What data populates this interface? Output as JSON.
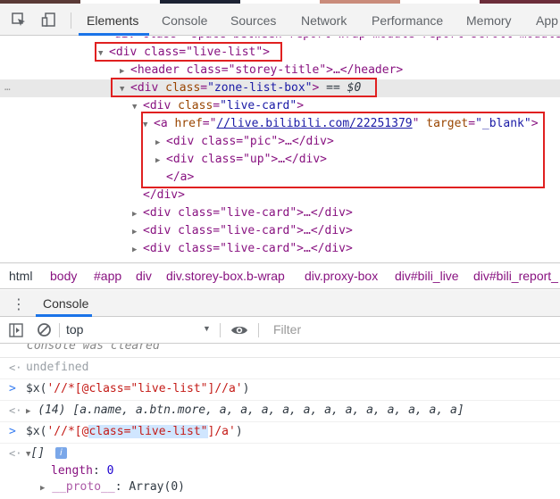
{
  "topbar": {
    "tabs": [
      "Elements",
      "Console",
      "Sources",
      "Network",
      "Performance",
      "Memory",
      "App"
    ],
    "active_tab": "Elements"
  },
  "tree": {
    "cut_line": "‹div class=\"space-between report-wrap-module report-scroll-module›",
    "live_list_open": "<div class=\"live-list\">",
    "header_line": "<header class=\"storey-title\">…</header>",
    "zone_list_tag": "div",
    "zone_list_attr": "class",
    "zone_list_val": "\"zone-list-box\"",
    "zone_list_suffix": "== $0",
    "live_card_tag": "div",
    "live_card_attr": "class",
    "live_card_val": "\"live-card\"",
    "a_tag": "a",
    "a_href_attr": "href",
    "a_href_val": "//live.bilibili.com/22251379",
    "a_target_attr": "target",
    "a_target_val": "\"_blank\"",
    "pic_line": "<div class=\"pic\">…</div>",
    "up_line": "<div class=\"up\">…</div>",
    "a_close": "</a>",
    "div_close": "</div>",
    "live_card_collapsed": "<div class=\"live-card\">…</div>",
    "dots": "…"
  },
  "breadcrumb": [
    "html",
    "body",
    "#app",
    "div",
    "div.storey-box.b-wrap",
    "div.proxy-box",
    "div#bili_live",
    "div#bili_report_"
  ],
  "drawer": {
    "title": "Console",
    "kebab": "⋮"
  },
  "console_toolbar": {
    "context": "top",
    "filter_placeholder": "Filter"
  },
  "console": {
    "cleared": "Console was cleared",
    "undefined_result": "undefined",
    "cmd1_prefix": "$x(",
    "cmd1_str": "'//*[@class=\"live-list\"]//a'",
    "cmd1_suffix": ")",
    "result1_count": "(14)",
    "result1_items": "[a.name, a.btn.more, a, a, a, a, a, a, a, a, a, a, a, a]",
    "cmd2_prefix": "$x(",
    "cmd2_str_a": "'//*[@",
    "cmd2_str_hl": "class=\"live-list\"",
    "cmd2_str_b": "]/a'",
    "cmd2_suffix": ")",
    "result2": "[]",
    "length_key": "length",
    "length_val": "0",
    "proto_key": "__proto__",
    "proto_val": "Array(0)"
  },
  "colors": {
    "tag": "#881280",
    "attr": "#994500",
    "value": "#1a1aa6",
    "highlight_box": "#e02020",
    "active_tab_underline": "#1a73e8"
  }
}
